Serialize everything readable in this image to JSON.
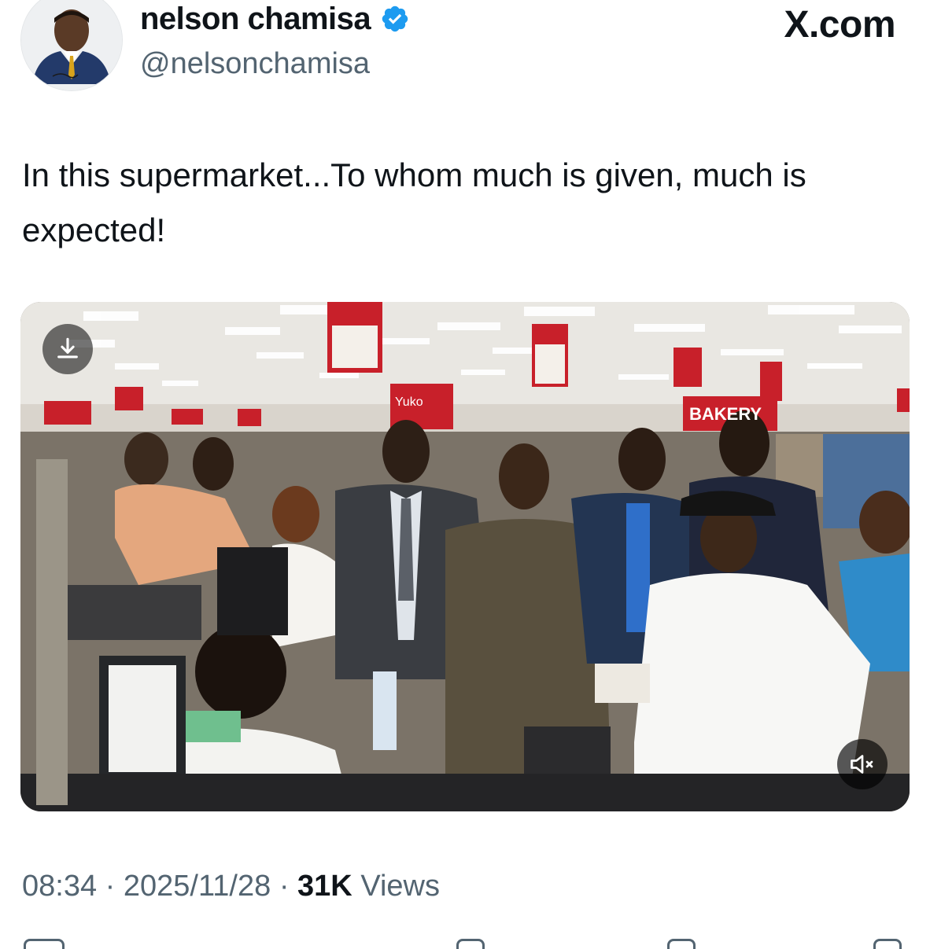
{
  "author": {
    "display_name": "nelson chamisa",
    "handle": "@nelsonchamisa",
    "verified": true,
    "verified_color": "#1d9bf0",
    "avatar_icon": "profile-photo"
  },
  "brand": {
    "site_label": "X.com"
  },
  "tweet": {
    "text": "In this supermarket...To whom much is given, much is expected!"
  },
  "media": {
    "type": "video",
    "download_icon": "download-icon",
    "mute_icon": "speaker-muted-icon",
    "store_signs": [
      "Yuko",
      "BAKERY"
    ],
    "accent_color": "#c8202a"
  },
  "meta": {
    "time": "08:34",
    "separator": "·",
    "date": "2025/11/28",
    "views_count": "31K",
    "views_label": "Views"
  }
}
